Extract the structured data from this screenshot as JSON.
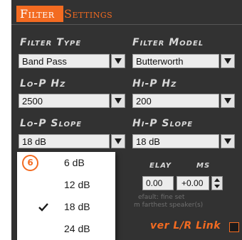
{
  "header": {
    "title_first": "Filter",
    "title_second": "Settings"
  },
  "filter_type": {
    "label": "Filter Type",
    "value": "Band Pass"
  },
  "filter_model": {
    "label": "Filter Model",
    "value": "Butterworth"
  },
  "lo_p_hz": {
    "label": "Lo-P Hz",
    "value": "2500"
  },
  "hi_p_hz": {
    "label": "Hi-P Hz",
    "value": "200"
  },
  "lo_p_slope": {
    "label": "Lo-P Slope",
    "value": "18 dB"
  },
  "hi_p_slope": {
    "label": "Hi-P Slope",
    "value": "18 dB"
  },
  "delay": {
    "label_visible": "elay",
    "unit": "ms",
    "left_value": "0.00",
    "right_value": "+0.00",
    "note_line1": "efault: fine set",
    "note_line2": "m farthest speaker(s)"
  },
  "bottom_link": {
    "label": "ver L/R Link"
  },
  "slope_menu": {
    "options": [
      "6 dB",
      "12 dB",
      "18 dB",
      "24 dB"
    ],
    "selected": "18 dB"
  },
  "callout": {
    "number": "6"
  },
  "colors": {
    "accent": "#f36b21",
    "panel": "#323232"
  }
}
